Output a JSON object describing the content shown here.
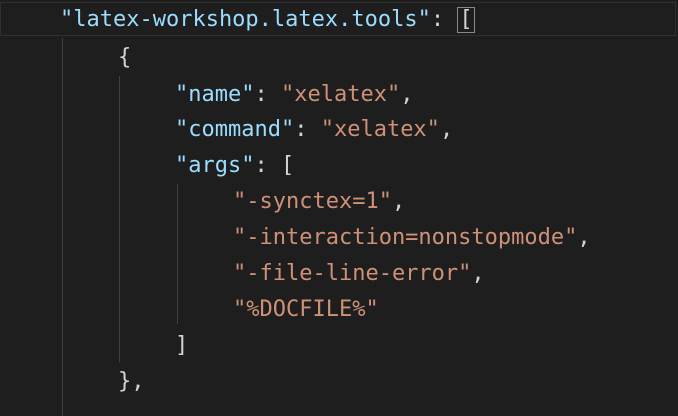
{
  "editor": {
    "lines": [
      {
        "key": "\"latex-workshop.latex.tools\"",
        "sep": ": ",
        "bracket": "["
      },
      {
        "text": "{"
      },
      {
        "key": "\"name\"",
        "sep": ": ",
        "value": "\"xelatex\"",
        "trail": ","
      },
      {
        "key": "\"command\"",
        "sep": ": ",
        "value": "\"xelatex\"",
        "trail": ","
      },
      {
        "key": "\"args\"",
        "sep": ": ",
        "trail": "["
      },
      {
        "value": "\"-synctex=1\"",
        "trail": ","
      },
      {
        "value": "\"-interaction=nonstopmode\"",
        "trail": ","
      },
      {
        "value": "\"-file-line-error\"",
        "trail": ","
      },
      {
        "value": "\"%DOCFILE%\""
      },
      {
        "text": "]"
      },
      {
        "text": "},"
      }
    ]
  },
  "colors": {
    "background": "#1e1e1e",
    "property_key": "#9cdcfe",
    "string_value": "#ce9178",
    "punctuation": "#d4d4d4",
    "indent_guide": "#404040"
  }
}
